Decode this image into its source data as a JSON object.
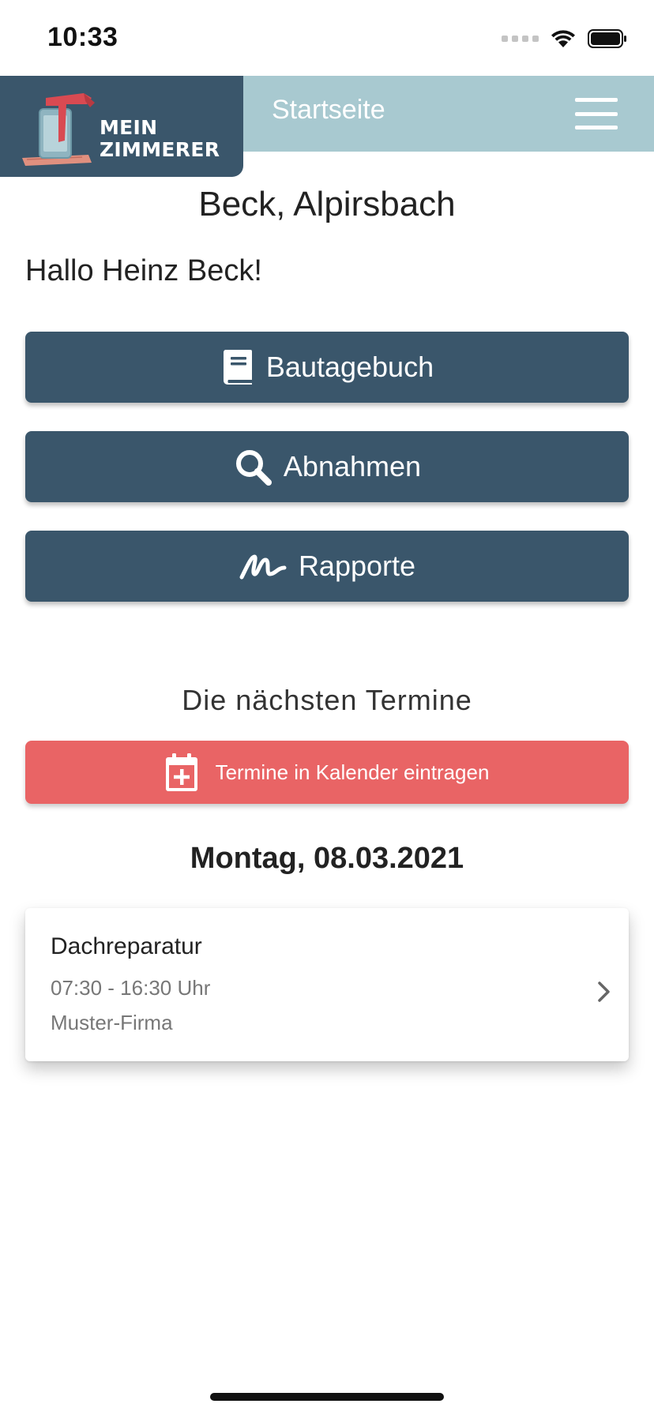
{
  "status_bar": {
    "time": "10:33"
  },
  "header": {
    "logo_line1": "MEIN",
    "logo_line2": "ZIMMERER",
    "title": "Startseite",
    "menu_icon": "hamburger-icon"
  },
  "main": {
    "location": "Beck, Alpirsbach",
    "greeting": "Hallo Heinz Beck!",
    "buttons": [
      {
        "label": "Bautagebuch",
        "icon": "book-icon"
      },
      {
        "label": "Abnahmen",
        "icon": "search-icon"
      },
      {
        "label": "Rapporte",
        "icon": "signature-icon"
      }
    ],
    "appointments_title": "Die nächsten Termine",
    "calendar_button": {
      "label": "Termine in Kalender eintragen",
      "icon": "calendar-plus-icon"
    },
    "date_heading": "Montag, 08.03.2021",
    "events": [
      {
        "title": "Dachreparatur",
        "time": "07:30 - 16:30 Uhr",
        "company": "Muster-Firma"
      }
    ]
  },
  "colors": {
    "primary": "#3a566b",
    "header_bar": "#a8c9d0",
    "accent_red": "#e96465"
  }
}
